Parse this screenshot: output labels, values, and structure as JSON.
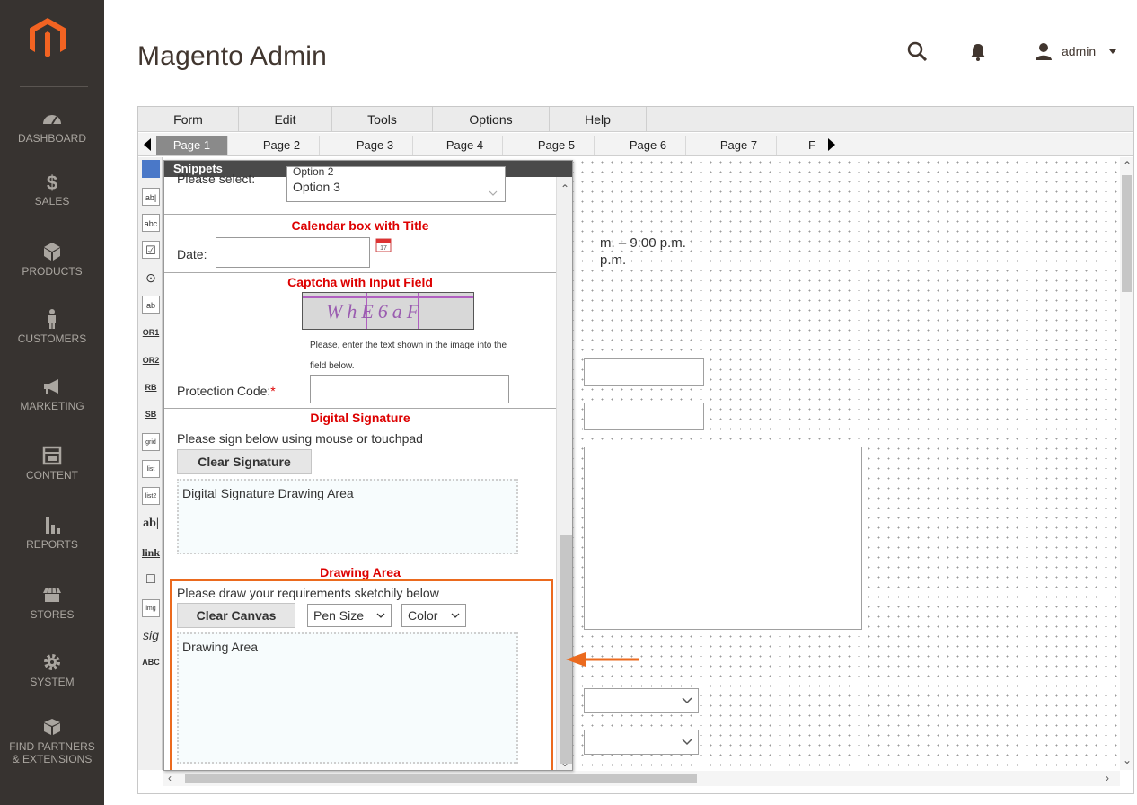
{
  "app": {
    "title": "Magento Admin",
    "user": "admin"
  },
  "sidebar": {
    "items": [
      {
        "label": "DASHBOARD",
        "icon": "dashboard-icon"
      },
      {
        "label": "SALES",
        "icon": "dollar-icon"
      },
      {
        "label": "PRODUCTS",
        "icon": "cube-icon"
      },
      {
        "label": "CUSTOMERS",
        "icon": "person-icon"
      },
      {
        "label": "MARKETING",
        "icon": "megaphone-icon"
      },
      {
        "label": "CONTENT",
        "icon": "layout-icon"
      },
      {
        "label": "REPORTS",
        "icon": "bar-chart-icon"
      },
      {
        "label": "STORES",
        "icon": "store-icon"
      },
      {
        "label": "SYSTEM",
        "icon": "gear-icon"
      },
      {
        "label": "FIND PARTNERS",
        "label2": "& EXTENSIONS",
        "icon": "box-icon"
      }
    ]
  },
  "menu": [
    "Form",
    "Edit",
    "Tools",
    "Options",
    "Help"
  ],
  "tabs": [
    "Page 1",
    "Page 2",
    "Page 3",
    "Page 4",
    "Page 5",
    "Page 6",
    "Page 7",
    "F"
  ],
  "canvas": {
    "line1": "m. – 9:00 p.m.",
    "line2": "p.m."
  },
  "toolbox": [
    "ab|",
    "abc",
    "☑",
    "⊙",
    "ab",
    "OR1",
    "OR2",
    "RB",
    "SB",
    "grid",
    "list",
    "list2",
    "ab|",
    "link",
    "□",
    "img",
    "sig",
    "ABC"
  ],
  "snippets": {
    "header": "Snippets",
    "select_label": "Please select:",
    "select_option_top": "Option 2",
    "select_option": "Option 3",
    "calendar_title": "Calendar box with Title",
    "date_label": "Date:",
    "captcha_title": "Captcha with Input Field",
    "captcha_text": "WhE6aF",
    "captcha_help1": "Please, enter the text shown in the image into the",
    "captcha_help2": "field below.",
    "protection_label": "Protection Code:",
    "protection_required": "*",
    "signature_title": "Digital Signature",
    "signature_help": "Please sign below using mouse or touchpad",
    "clear_signature": "Clear Signature",
    "signature_area": "Digital Signature Drawing Area",
    "drawing_title": "Drawing Area",
    "drawing_help": "Please draw your requirements sketchily below",
    "clear_canvas": "Clear Canvas",
    "pen_size": "Pen Size",
    "color": "Color",
    "drawing_area": "Drawing Area"
  },
  "colors": {
    "sidebar_bg": "#373330",
    "accent": "#eb6a1e",
    "snippet_title": "#dd0000",
    "logo": "#f26322"
  }
}
